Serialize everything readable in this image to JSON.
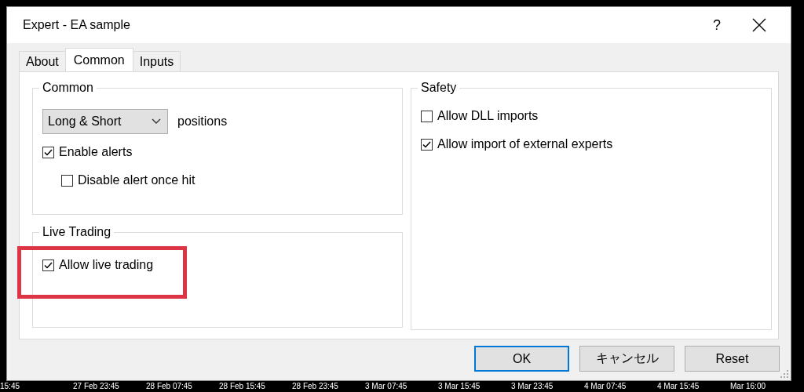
{
  "window": {
    "title": "Expert - EA sample",
    "help": "?"
  },
  "tabs": [
    {
      "label": "About",
      "selected": false
    },
    {
      "label": "Common",
      "selected": true
    },
    {
      "label": "Inputs",
      "selected": false
    }
  ],
  "common_group": {
    "title": "Common",
    "dropdown": {
      "value": "Long & Short"
    },
    "dropdown_label": "positions",
    "checkboxes": [
      {
        "label": "Enable alerts",
        "checked": true,
        "children": [
          {
            "label": "Disable alert once hit",
            "checked": false
          }
        ]
      }
    ]
  },
  "live_trading_group": {
    "title": "Live Trading",
    "checkboxes": [
      {
        "label": "Allow live trading",
        "checked": true,
        "highlighted": true
      }
    ]
  },
  "safety_group": {
    "title": "Safety",
    "checkboxes": [
      {
        "label": "Allow DLL imports",
        "checked": false
      },
      {
        "label": "Allow import of external experts",
        "checked": true
      }
    ]
  },
  "buttons": [
    {
      "label": "OK",
      "default": true
    },
    {
      "label": "キャンセル",
      "default": false
    },
    {
      "label": "Reset",
      "default": false
    }
  ],
  "chart_axis": {
    "labels": [
      "15:45",
      "27 Feb 23:45",
      "28 Feb 07:45",
      "28 Feb 15:45",
      "28 Feb 23:45",
      "3 Mar 07:45",
      "3 Mar 15:45",
      "3 Mar 23:45",
      "4 Mar 07:45",
      "4 Mar 15:45",
      "Mar 16:00"
    ]
  }
}
